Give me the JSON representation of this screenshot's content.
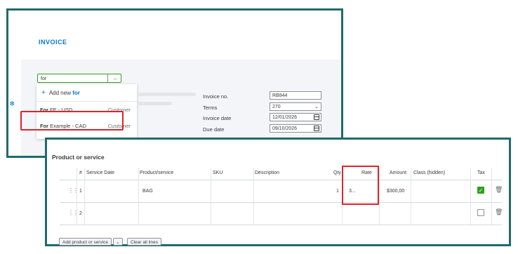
{
  "invoice": {
    "title": "INVOICE",
    "customer_input_value": "for",
    "dropdown": {
      "add_new_prefix": "Add new",
      "add_new_keyword": "for",
      "options": [
        {
          "bold": "For",
          "rest": " FE  - USD",
          "type": "Customer"
        },
        {
          "bold": "For",
          "rest": " Example  - CAD",
          "type": "Customer"
        }
      ]
    },
    "fields": {
      "invoice_no_label": "Invoice no.",
      "invoice_no_value": "RB844",
      "terms_label": "Terms",
      "terms_value": "270",
      "invoice_date_label": "Invoice date",
      "invoice_date_value": "12/01/2026",
      "due_date_label": "Due date",
      "due_date_value": "09/10/2026"
    }
  },
  "products": {
    "title": "Product or service",
    "columns": {
      "num": "#",
      "service_date": "Service Date",
      "product": "Product/service",
      "sku": "SKU",
      "description": "Description",
      "qty": "Qty",
      "rate": "Rate",
      "amount": "Amount",
      "class": "Class (hidden)",
      "tax": "Tax"
    },
    "rows": [
      {
        "num": "1",
        "product": "BAG",
        "qty": "1",
        "rate": "3...",
        "amount": "$300,00",
        "tax": true
      },
      {
        "num": "2",
        "product": "",
        "qty": "",
        "rate": "",
        "amount": "",
        "tax": false
      }
    ],
    "buttons": {
      "add_product": "Add product or service",
      "clear_lines": "Clear all lines"
    }
  },
  "colors": {
    "accent": "#0077c5",
    "success": "#2ca01c",
    "highlight": "#e0232a",
    "panel_border": "#1f6b6b"
  }
}
